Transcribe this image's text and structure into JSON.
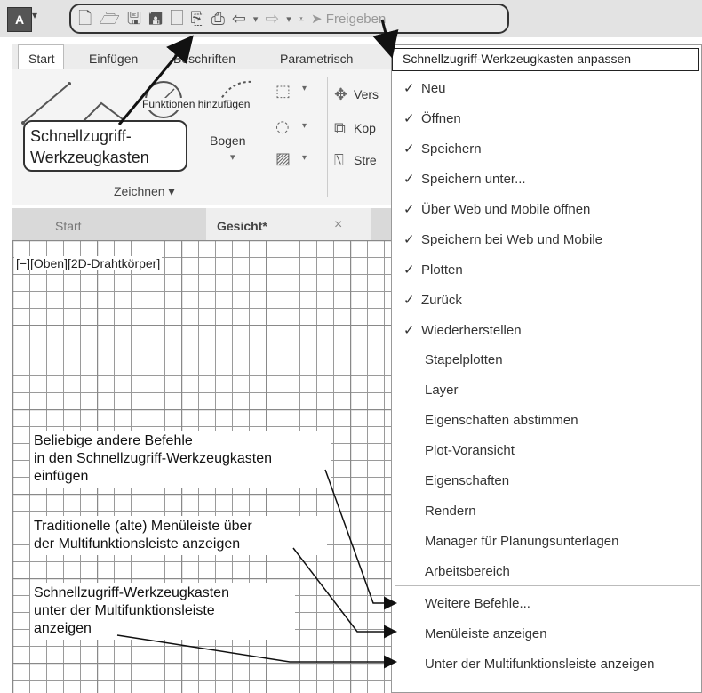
{
  "toolbar": {
    "app_letter": "A",
    "share_label": "Freigeben"
  },
  "ribbon": {
    "tabs": [
      "Start",
      "Einfügen",
      "Beschriften",
      "Parametrisch"
    ],
    "panel_label": "Zeichnen",
    "bogen_label": "Bogen",
    "modify_items": [
      "Vers",
      "Kop",
      "Stre"
    ]
  },
  "doc_tabs": {
    "start": "Start",
    "active": "Gesicht*",
    "close": "×"
  },
  "viewport": {
    "label": "[−][Oben][2D-Drahtkörper]"
  },
  "annotations": {
    "qat_callout": [
      "Schnellzugriff-",
      "Werkzeugkasten"
    ],
    "functions_label": "Funktionen hinzufügen",
    "note1": [
      "Beliebige andere Befehle",
      "in den Schnellzugriff-Werkzeugkasten",
      "einfügen"
    ],
    "note2": [
      "Traditionelle  (alte) Menüleiste über",
      "der Multifunktionsleiste anzeigen"
    ],
    "note3_line1": "Schnellzugriff-Werkzeugkasten",
    "note3_underlined": "unter",
    "note3_rest": " der Multifunktionsleiste",
    "note3_line3": "anzeigen"
  },
  "menu": {
    "header": "Schnellzugriff-Werkzeugkasten anpassen",
    "checkmark": "✓",
    "items": [
      {
        "label": "Neu",
        "checked": true
      },
      {
        "label": "Öffnen",
        "checked": true
      },
      {
        "label": "Speichern",
        "checked": true
      },
      {
        "label": "Speichern unter...",
        "checked": true
      },
      {
        "label": "Über Web und Mobile öffnen",
        "checked": true
      },
      {
        "label": "Speichern bei Web und Mobile",
        "checked": true
      },
      {
        "label": "Plotten",
        "checked": true
      },
      {
        "label": "Zurück",
        "checked": true
      },
      {
        "label": "Wiederherstellen",
        "checked": true
      },
      {
        "label": "Stapelplotten",
        "checked": false
      },
      {
        "label": "Layer",
        "checked": false
      },
      {
        "label": "Eigenschaften abstimmen",
        "checked": false
      },
      {
        "label": "Plot-Voransicht",
        "checked": false
      },
      {
        "label": "Eigenschaften",
        "checked": false
      },
      {
        "label": "Rendern",
        "checked": false
      },
      {
        "label": "Manager für Planungsunterlagen",
        "checked": false
      },
      {
        "label": "Arbeitsbereich",
        "checked": false
      }
    ],
    "extra_items": [
      "Weitere Befehle...",
      "Menüleiste anzeigen",
      "Unter der Multifunktionsleiste anzeigen"
    ]
  }
}
